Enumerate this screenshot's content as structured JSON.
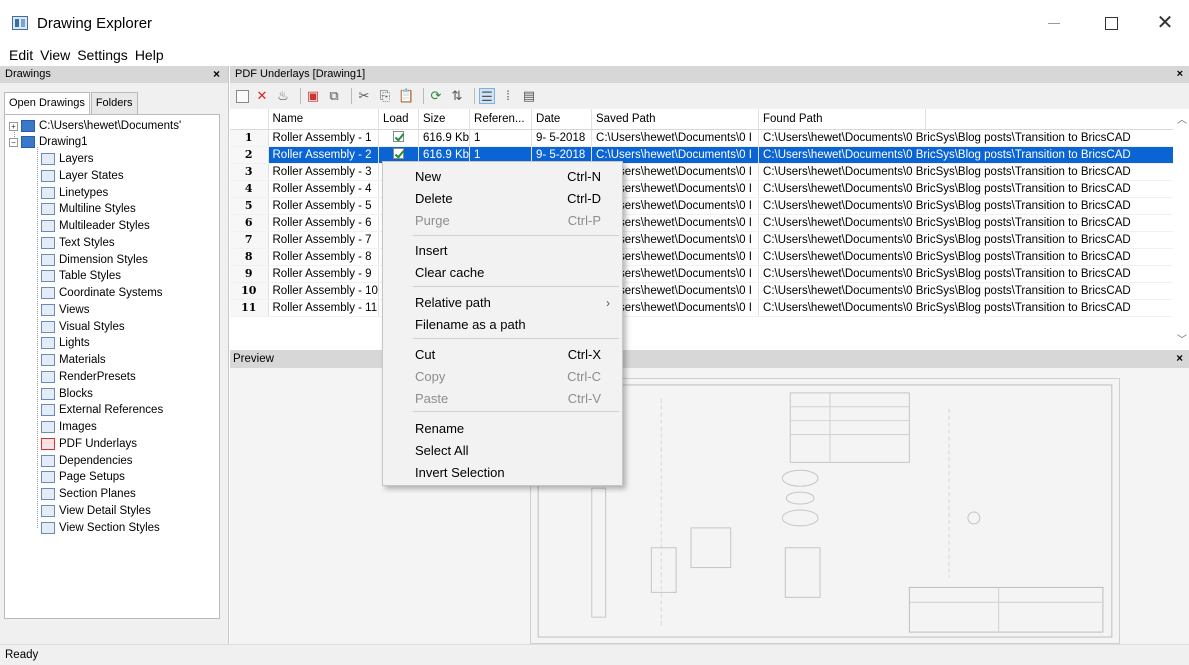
{
  "window": {
    "title": "Drawing Explorer",
    "close_glyph": "✕"
  },
  "menubar": {
    "items": [
      "Edit",
      "View",
      "Settings",
      "Help"
    ]
  },
  "left_panel": {
    "title": "Drawings",
    "tabs": [
      "Open Drawings",
      "Folders"
    ],
    "tree": {
      "documents_node": "C:\\Users\\hewet\\Documents'",
      "drawing_node": "Drawing1",
      "children": [
        {
          "label": "Layers",
          "icon": "layers-icon"
        },
        {
          "label": "Layer States",
          "icon": "layer-states-icon"
        },
        {
          "label": "Linetypes",
          "icon": "linetypes-icon"
        },
        {
          "label": "Multiline Styles",
          "icon": "multiline-styles-icon"
        },
        {
          "label": "Multileader Styles",
          "icon": "multileader-styles-icon"
        },
        {
          "label": "Text Styles",
          "icon": "text-styles-icon"
        },
        {
          "label": "Dimension Styles",
          "icon": "dimension-styles-icon"
        },
        {
          "label": "Table Styles",
          "icon": "table-styles-icon"
        },
        {
          "label": "Coordinate Systems",
          "icon": "coordinate-systems-icon"
        },
        {
          "label": "Views",
          "icon": "views-icon"
        },
        {
          "label": "Visual Styles",
          "icon": "visual-styles-icon"
        },
        {
          "label": "Lights",
          "icon": "lights-icon"
        },
        {
          "label": "Materials",
          "icon": "materials-icon"
        },
        {
          "label": "RenderPresets",
          "icon": "render-presets-icon"
        },
        {
          "label": "Blocks",
          "icon": "blocks-icon"
        },
        {
          "label": "External References",
          "icon": "external-references-icon"
        },
        {
          "label": "Images",
          "icon": "images-icon"
        },
        {
          "label": "PDF Underlays",
          "icon": "pdf-underlays-icon"
        },
        {
          "label": "Dependencies",
          "icon": "dependencies-icon"
        },
        {
          "label": "Page Setups",
          "icon": "page-setups-icon"
        },
        {
          "label": "Section Planes",
          "icon": "section-planes-icon"
        },
        {
          "label": "View Detail Styles",
          "icon": "view-detail-styles-icon"
        },
        {
          "label": "View Section Styles",
          "icon": "view-section-styles-icon"
        }
      ]
    }
  },
  "pdf_underlays": {
    "title": "PDF Underlays [Drawing1]",
    "columns": [
      "Name",
      "Load",
      "Size",
      "Referen...",
      "Date",
      "Saved Path",
      "Found Path"
    ],
    "rows": [
      {
        "n": "1",
        "name": "Roller Assembly - 1",
        "load": true,
        "size": "616.9 Kb",
        "ref": "1",
        "date": "9- 5-2018",
        "saved": "C:\\Users\\hewet\\Documents\\0 I",
        "found": "C:\\Users\\hewet\\Documents\\0 BricSys\\Blog posts\\Transition to BricsCAD"
      },
      {
        "n": "2",
        "name": "Roller Assembly - 2",
        "load": true,
        "size": "616.9 Kb",
        "ref": "1",
        "date": "9- 5-2018",
        "saved": "C:\\Users\\hewet\\Documents\\0 I",
        "found": "C:\\Users\\hewet\\Documents\\0 BricSys\\Blog posts\\Transition to BricsCAD"
      },
      {
        "n": "3",
        "name": "Roller Assembly - 3",
        "load": true,
        "size": "",
        "ref": "",
        "date": "",
        "saved": "C:\\Users\\hewet\\Documents\\0 I",
        "found": "C:\\Users\\hewet\\Documents\\0 BricSys\\Blog posts\\Transition to BricsCAD"
      },
      {
        "n": "4",
        "name": "Roller Assembly - 4",
        "load": true,
        "size": "",
        "ref": "",
        "date": "",
        "saved": "C:\\Users\\hewet\\Documents\\0 I",
        "found": "C:\\Users\\hewet\\Documents\\0 BricSys\\Blog posts\\Transition to BricsCAD"
      },
      {
        "n": "5",
        "name": "Roller Assembly - 5",
        "load": true,
        "size": "",
        "ref": "",
        "date": "",
        "saved": "C:\\Users\\hewet\\Documents\\0 I",
        "found": "C:\\Users\\hewet\\Documents\\0 BricSys\\Blog posts\\Transition to BricsCAD"
      },
      {
        "n": "6",
        "name": "Roller Assembly - 6",
        "load": true,
        "size": "",
        "ref": "",
        "date": "",
        "saved": "C:\\Users\\hewet\\Documents\\0 I",
        "found": "C:\\Users\\hewet\\Documents\\0 BricSys\\Blog posts\\Transition to BricsCAD"
      },
      {
        "n": "7",
        "name": "Roller Assembly - 7",
        "load": true,
        "size": "",
        "ref": "",
        "date": "",
        "saved": "C:\\Users\\hewet\\Documents\\0 I",
        "found": "C:\\Users\\hewet\\Documents\\0 BricSys\\Blog posts\\Transition to BricsCAD"
      },
      {
        "n": "8",
        "name": "Roller Assembly - 8",
        "load": true,
        "size": "",
        "ref": "",
        "date": "",
        "saved": "C:\\Users\\hewet\\Documents\\0 I",
        "found": "C:\\Users\\hewet\\Documents\\0 BricSys\\Blog posts\\Transition to BricsCAD"
      },
      {
        "n": "9",
        "name": "Roller Assembly - 9",
        "load": true,
        "size": "",
        "ref": "",
        "date": "",
        "saved": "C:\\Users\\hewet\\Documents\\0 I",
        "found": "C:\\Users\\hewet\\Documents\\0 BricSys\\Blog posts\\Transition to BricsCAD"
      },
      {
        "n": "10",
        "name": "Roller Assembly - 10",
        "load": true,
        "size": "",
        "ref": "",
        "date": "",
        "saved": "C:\\Users\\hewet\\Documents\\0 I",
        "found": "C:\\Users\\hewet\\Documents\\0 BricSys\\Blog posts\\Transition to BricsCAD"
      },
      {
        "n": "11",
        "name": "Roller Assembly - 11",
        "load": true,
        "size": "",
        "ref": "",
        "date": "",
        "saved": "C:\\Users\\hewet\\Documents\\0 I",
        "found": "C:\\Users\\hewet\\Documents\\0 BricSys\\Blog posts\\Transition to BricsCAD"
      }
    ],
    "selected_row": 2
  },
  "preview": {
    "title": "Preview"
  },
  "context_menu": {
    "items": [
      {
        "label": "New",
        "shortcut": "Ctrl-N",
        "enabled": true
      },
      {
        "label": "Delete",
        "shortcut": "Ctrl-D",
        "enabled": true
      },
      {
        "label": "Purge",
        "shortcut": "Ctrl-P",
        "enabled": false
      },
      {
        "label": "Insert",
        "shortcut": "",
        "enabled": true
      },
      {
        "label": "Clear cache",
        "shortcut": "",
        "enabled": true
      },
      {
        "label": "Relative path",
        "shortcut": "",
        "enabled": true,
        "submenu": true
      },
      {
        "label": "Filename as a path",
        "shortcut": "",
        "enabled": true
      },
      {
        "label": "Cut",
        "shortcut": "Ctrl-X",
        "enabled": true
      },
      {
        "label": "Copy",
        "shortcut": "Ctrl-C",
        "enabled": false
      },
      {
        "label": "Paste",
        "shortcut": "Ctrl-V",
        "enabled": false
      },
      {
        "label": "Rename",
        "shortcut": "",
        "enabled": true
      },
      {
        "label": "Select All",
        "shortcut": "",
        "enabled": true
      },
      {
        "label": "Invert Selection",
        "shortcut": "",
        "enabled": true
      }
    ]
  },
  "status": {
    "text": "Ready"
  },
  "colors": {
    "selection": "#0a64d4",
    "panel_header": "#d7d7d7",
    "check": "#1f8f3a"
  }
}
